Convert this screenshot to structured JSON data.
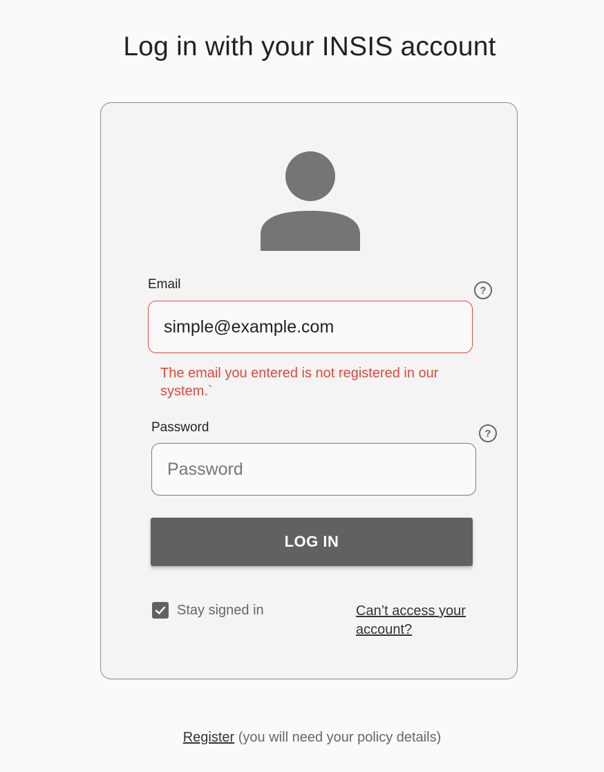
{
  "page": {
    "title": "Log in with your INSIS account"
  },
  "form": {
    "email": {
      "label": "Email",
      "value": "simple@example.com",
      "help": "?",
      "error": "The email you entered is not registered in our system.`"
    },
    "password": {
      "label": "Password",
      "placeholder": "Password",
      "help": "?"
    },
    "login_label": "LOG IN",
    "stay_signed_in": {
      "label": "Stay signed in",
      "checked": true
    },
    "cant_access": "Can’t access your account?"
  },
  "footer": {
    "register_link": "Register",
    "note": " (you will need your policy details)"
  },
  "colors": {
    "error": "#e2483c",
    "button": "#616161",
    "icon": "#757575"
  },
  "icons": {
    "avatar": "user-avatar-icon",
    "help": "help-circle-icon",
    "check": "checkmark-icon"
  }
}
